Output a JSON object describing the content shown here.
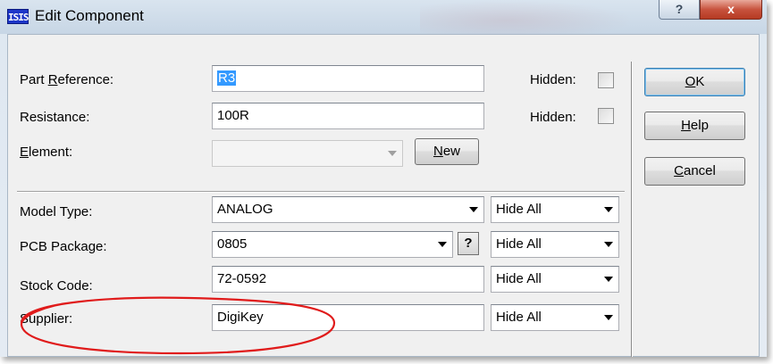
{
  "window": {
    "title": "Edit Component",
    "icon": "isis-app-icon",
    "icon_text": "ISIS",
    "help_button": "?",
    "close_button": "x"
  },
  "fields": {
    "part_reference": {
      "label_pre": "Part ",
      "label_key": "R",
      "label_post": "eference:",
      "value": "R3",
      "hidden_label": "Hidden:",
      "hidden_checked": false
    },
    "resistance": {
      "label": "Resistance:",
      "value": "100R",
      "hidden_label": "Hidden:",
      "hidden_checked": false
    },
    "element": {
      "label_key": "E",
      "label_post": "lement:",
      "value": "",
      "new_pre": "",
      "new_key": "N",
      "new_post": "ew"
    },
    "model_type": {
      "label": "Model Type:",
      "value": "ANALOG",
      "visibility": "Hide All"
    },
    "pcb_package": {
      "label": "PCB Package:",
      "value": "0805",
      "help": "?",
      "visibility": "Hide All"
    },
    "stock_code": {
      "label": "Stock Code:",
      "value": "72-0592",
      "visibility": "Hide All"
    },
    "supplier": {
      "label": "Supplier:",
      "value": "DigiKey",
      "visibility": "Hide All"
    }
  },
  "buttons": {
    "ok": {
      "key": "O",
      "rest": "K"
    },
    "help": {
      "key": "H",
      "rest": "elp"
    },
    "cancel": {
      "key": "C",
      "rest": "ancel"
    }
  },
  "colors": {
    "annotation": "#e01b1b",
    "selection": "#3399ff",
    "close_button": "#c8533e"
  }
}
